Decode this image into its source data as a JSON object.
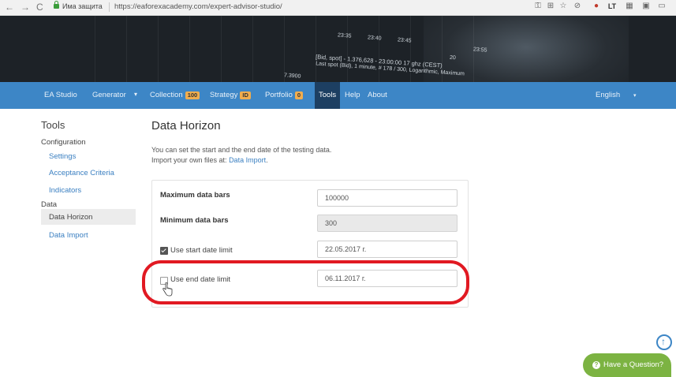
{
  "browser": {
    "back_glyph": "←",
    "forward_glyph": "→",
    "reload_glyph": "C",
    "secure_text": "Има защита",
    "url": "https://eaforexacademy.com/expert-advisor-studio/"
  },
  "banner": {
    "times": [
      "23:35",
      "23:40",
      "23:45",
      "23:55",
      "20"
    ],
    "ticker_line1": "[Bid, spot] - 1.376,628 - 23:00:00 17 ghz (CEST)",
    "ticker_line2": "Last spot (Bid), 1 minute, # 178 / 300, Logarithmic, Maximum",
    "price_label": "7.3900"
  },
  "nav": {
    "items": {
      "ea_studio": "EA Studio",
      "generator": "Generator",
      "collection": "Collection",
      "collection_badge": "100",
      "strategy": "Strategy",
      "strategy_badge": "ID",
      "portfolio": "Portfolio",
      "portfolio_badge": "0",
      "tools": "Tools",
      "help": "Help",
      "about": "About"
    },
    "language": "English",
    "colors": {
      "bar": "#3d86c6",
      "active": "#1d3f62",
      "badge": "#f0ad4e"
    }
  },
  "sidebar": {
    "title": "Tools",
    "group_configuration": "Configuration",
    "settings": "Settings",
    "acceptance_criteria": "Acceptance Criteria",
    "indicators": "Indicators",
    "group_data": "Data",
    "data_horizon": "Data Horizon",
    "data_import": "Data Import"
  },
  "main": {
    "title": "Data Horizon",
    "desc1": "You can set the start and the end date of the testing data.",
    "desc2_prefix": "Import your own files at:",
    "desc2_link": "Data Import",
    "desc2_suffix": ".",
    "fields": {
      "max_bars_label": "Maximum data bars",
      "max_bars_value": "100000",
      "min_bars_label": "Minimum data bars",
      "min_bars_value": "300",
      "start_label": "Use start date limit",
      "start_value": "22.05.2017 г.",
      "start_checked": true,
      "end_label": "Use end date limit",
      "end_value": "06.11.2017 г.",
      "end_checked": false
    }
  },
  "floating": {
    "question_label": "Have a Question?",
    "question_glyph": "?"
  },
  "accent": {
    "highlight": "#e11922",
    "question": "#7cb342"
  }
}
